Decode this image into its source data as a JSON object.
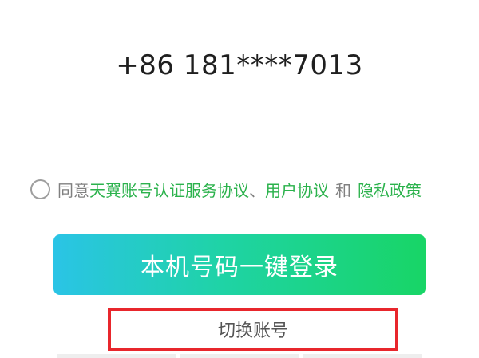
{
  "phone_number": "+86 181****7013",
  "agreement": {
    "prefix": "同意",
    "link_1": "天翼账号认证服务协议",
    "separator": "、",
    "link_2": "用户协议",
    "conjunction": "和",
    "link_3": "隐私政策",
    "checked": false
  },
  "login_button": {
    "label": "本机号码一键登录"
  },
  "switch_account": {
    "label": "切换账号",
    "highlight_color": "#e8262c"
  },
  "colors": {
    "link": "#2bb24c",
    "button_gradient_start": "#2ac4e6",
    "button_gradient_end": "#18d566"
  }
}
